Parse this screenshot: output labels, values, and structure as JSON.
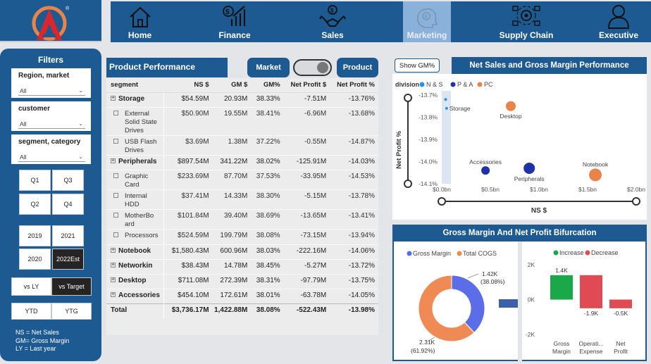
{
  "nav": {
    "items": [
      {
        "label": "Home",
        "icon": "home-icon"
      },
      {
        "label": "Finance",
        "icon": "finance-chart-icon"
      },
      {
        "label": "Sales",
        "icon": "handshake-icon"
      },
      {
        "label": "Marketing",
        "icon": "marketing-brain-icon"
      },
      {
        "label": "Supply Chain",
        "icon": "supply-chain-icon"
      },
      {
        "label": "Executive",
        "icon": "executive-person-icon"
      }
    ],
    "active": "Marketing"
  },
  "filters": {
    "title": "Filters",
    "slicers": [
      {
        "label": "Region, market",
        "value": "All"
      },
      {
        "label": "customer",
        "value": "All"
      },
      {
        "label": "segment, category",
        "value": "All"
      }
    ],
    "quarters": [
      "Q1",
      "Q3",
      "Q2",
      "Q4"
    ],
    "years": [
      "2019",
      "2021",
      "2020",
      "2022Est"
    ],
    "selected_year": "2022Est",
    "compare": [
      "vs LY",
      "vs Target"
    ],
    "selected_compare": "vs Target",
    "period": [
      "YTD",
      "YTG"
    ],
    "legend": [
      "NS = Net Sales",
      "GM= Gross Margin",
      "LY = Last year"
    ]
  },
  "product_performance": {
    "title": "Product Performance",
    "toggle_left": "Market",
    "toggle_right": "Product",
    "columns": [
      "segment",
      "NS $",
      "GM $",
      "GM%",
      "Net Profit $",
      "Net Profit %"
    ],
    "rows": [
      {
        "type": "group",
        "cells": [
          "Storage",
          "$54.59M",
          "20.93M",
          "38.33%",
          "-7.51M",
          "-13.76%"
        ]
      },
      {
        "type": "sub",
        "cells": [
          "External Solid State Drives",
          "$50.90M",
          "19.55M",
          "38.41%",
          "-6.96M",
          "-13.68%"
        ]
      },
      {
        "type": "sub",
        "cells": [
          "USB Flash Drives",
          "$3.69M",
          "1.38M",
          "37.22%",
          "-0.55M",
          "-14.87%"
        ]
      },
      {
        "type": "group",
        "cells": [
          "Peripherals",
          "$897.54M",
          "341.22M",
          "38.02%",
          "-125.91M",
          "-14.03%"
        ]
      },
      {
        "type": "sub",
        "cells": [
          "Graphic Card",
          "$233.69M",
          "87.70M",
          "37.53%",
          "-33.95M",
          "-14.53%"
        ]
      },
      {
        "type": "sub",
        "cells": [
          "Internal HDD",
          "$37.41M",
          "14.33M",
          "38.30%",
          "-5.15M",
          "-13.78%"
        ]
      },
      {
        "type": "sub",
        "cells": [
          "MotherBo ard",
          "$101.84M",
          "39.40M",
          "38.69%",
          "-13.65M",
          "-13.41%"
        ]
      },
      {
        "type": "sub",
        "cells": [
          "Processors",
          "$524.59M",
          "199.79M",
          "38.08%",
          "-73.15M",
          "-13.94%"
        ]
      },
      {
        "type": "group",
        "cells": [
          "Notebook",
          "$1,580.43M",
          "600.96M",
          "38.03%",
          "-222.16M",
          "-14.06%"
        ]
      },
      {
        "type": "group",
        "cells": [
          "Networkin",
          "$38.43M",
          "14.78M",
          "38.45%",
          "-5.27M",
          "-13.72%"
        ]
      },
      {
        "type": "group",
        "cells": [
          "Desktop",
          "$711.08M",
          "272.39M",
          "38.31%",
          "-97.79M",
          "-13.75%"
        ]
      },
      {
        "type": "group",
        "cells": [
          "Accessories",
          "$454.10M",
          "172.61M",
          "38.01%",
          "-63.78M",
          "-14.05%"
        ]
      },
      {
        "type": "total",
        "cells": [
          "Total",
          "$3,736.17M",
          "1,422.88M",
          "38.08%",
          "-522.43M",
          "-13.98%"
        ]
      }
    ]
  },
  "scatter": {
    "button": "Show GM%",
    "title": "Net Sales and Gross Margin Performance",
    "legend_title": "division",
    "legend": [
      {
        "name": "N & S",
        "color": "#2f8ee8"
      },
      {
        "name": "P & A",
        "color": "#1f32a8"
      },
      {
        "name": "PC",
        "color": "#e8844a"
      }
    ],
    "ylabel": "Net Profit %",
    "xlabel": "NS $",
    "yticks": [
      "-13.7%",
      "-13.8%",
      "-13.9%",
      "-14.0%",
      "-14.1%"
    ],
    "xticks": [
      "$0.0bn",
      "$0.5bn",
      "$1.0bn",
      "$1.5bn",
      "$2.0bn"
    ]
  },
  "chart_data": [
    {
      "type": "scatter",
      "title": "Net Sales and Gross Margin Performance",
      "xlabel": "NS $",
      "ylabel": "Net Profit %",
      "xlim": [
        0,
        2.0
      ],
      "ylim": [
        -14.1,
        -13.7
      ],
      "legend_title": "division",
      "points": [
        {
          "label": "",
          "division": "N & S",
          "x": 0.04,
          "y": -13.72,
          "color": "#2f8ee8",
          "size": 2
        },
        {
          "label": "Storage",
          "division": "N & S",
          "x": 0.05,
          "y": -13.76,
          "color": "#2f8ee8",
          "size": 2
        },
        {
          "label": "Desktop",
          "division": "PC",
          "x": 0.71,
          "y": -13.75,
          "color": "#e8844a",
          "size": 7
        },
        {
          "label": "Accessories",
          "division": "P & A",
          "x": 0.45,
          "y": -14.04,
          "color": "#1f32a8",
          "size": 6
        },
        {
          "label": "Peripherals",
          "division": "P & A",
          "x": 0.9,
          "y": -14.03,
          "color": "#1f32a8",
          "size": 8
        },
        {
          "label": "Notebook",
          "division": "PC",
          "x": 1.58,
          "y": -14.06,
          "color": "#e8844a",
          "size": 9
        }
      ]
    },
    {
      "type": "pie",
      "title": "Gross Margin And Net Profit Bifurcation",
      "legend": [
        "Gross Margin",
        "Total COGS"
      ],
      "slices": [
        {
          "name": "Gross Margin",
          "value": 1.42,
          "label": "1.42K",
          "pct": "(38.08%)",
          "color": "#5b6ee8"
        },
        {
          "name": "Total COGS",
          "value": 2.31,
          "label": "2.31K",
          "pct": "(61.92%)",
          "color": "#f08a55"
        }
      ]
    },
    {
      "type": "bar",
      "subtype": "waterfall",
      "legend": [
        {
          "name": "Increase",
          "color": "#1aa84a"
        },
        {
          "name": "Decrease",
          "color": "#e04a55"
        }
      ],
      "categories": [
        "Gross Margin",
        "Operati... Expense",
        "Net Profit"
      ],
      "values": [
        1.4,
        -1.9,
        -0.5
      ],
      "labels": [
        "1.4K",
        "-1.9K",
        "-0.5K"
      ],
      "yticks": [
        "2K",
        "0K",
        "-2K"
      ],
      "ylim": [
        -2,
        2
      ]
    }
  ]
}
